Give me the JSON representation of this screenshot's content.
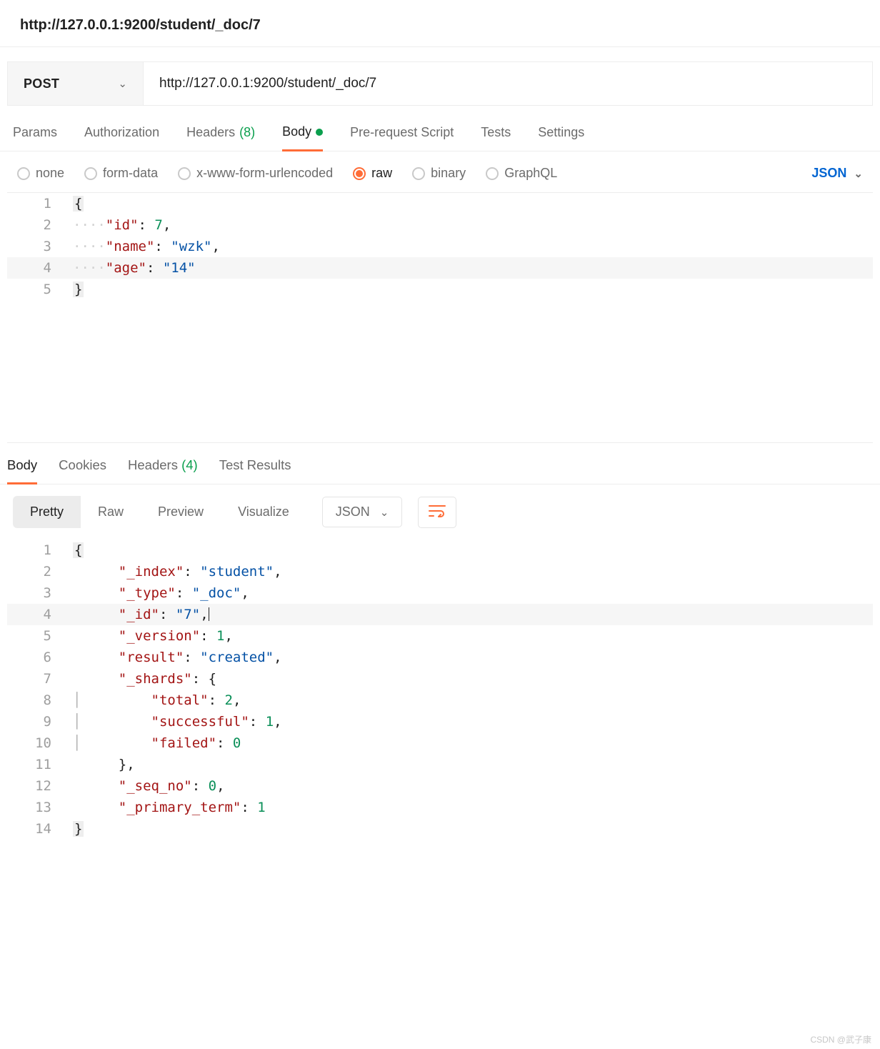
{
  "title": "http://127.0.0.1:9200/student/_doc/7",
  "request": {
    "method": "POST",
    "url": "http://127.0.0.1:9200/student/_doc/7"
  },
  "tabs": {
    "params": "Params",
    "auth": "Authorization",
    "headers": "Headers",
    "headers_count": "(8)",
    "body": "Body",
    "prereq": "Pre-request Script",
    "tests": "Tests",
    "settings": "Settings"
  },
  "bodyTypes": {
    "none": "none",
    "formdata": "form-data",
    "urlenc": "x-www-form-urlencoded",
    "raw": "raw",
    "binary": "binary",
    "graphql": "GraphQL"
  },
  "format": "JSON",
  "requestBody": {
    "lines": [
      "1",
      "2",
      "3",
      "4",
      "5"
    ],
    "tokens": {
      "id_key": "\"id\"",
      "id_val": "7",
      "name_key": "\"name\"",
      "name_val": "\"wzk\"",
      "age_key": "\"age\"",
      "age_val": "\"14\""
    }
  },
  "responseTabs": {
    "body": "Body",
    "cookies": "Cookies",
    "headers": "Headers",
    "headers_count": "(4)",
    "test": "Test Results"
  },
  "viewModes": {
    "pretty": "Pretty",
    "raw": "Raw",
    "preview": "Preview",
    "visualize": "Visualize"
  },
  "respFormat": "JSON",
  "responseBody": {
    "lines": [
      "1",
      "2",
      "3",
      "4",
      "5",
      "6",
      "7",
      "8",
      "9",
      "10",
      "11",
      "12",
      "13",
      "14"
    ],
    "t": {
      "l2k": "\"_index\"",
      "l2v": "\"student\"",
      "l3k": "\"_type\"",
      "l3v": "\"_doc\"",
      "l4k": "\"_id\"",
      "l4v": "\"7\"",
      "l5k": "\"_version\"",
      "l5v": "1",
      "l6k": "\"result\"",
      "l6v": "\"created\"",
      "l7k": "\"_shards\"",
      "l8k": "\"total\"",
      "l8v": "2",
      "l9k": "\"successful\"",
      "l9v": "1",
      "l10k": "\"failed\"",
      "l10v": "0",
      "l12k": "\"_seq_no\"",
      "l12v": "0",
      "l13k": "\"_primary_term\"",
      "l13v": "1"
    }
  },
  "watermark": "CSDN @武子康"
}
